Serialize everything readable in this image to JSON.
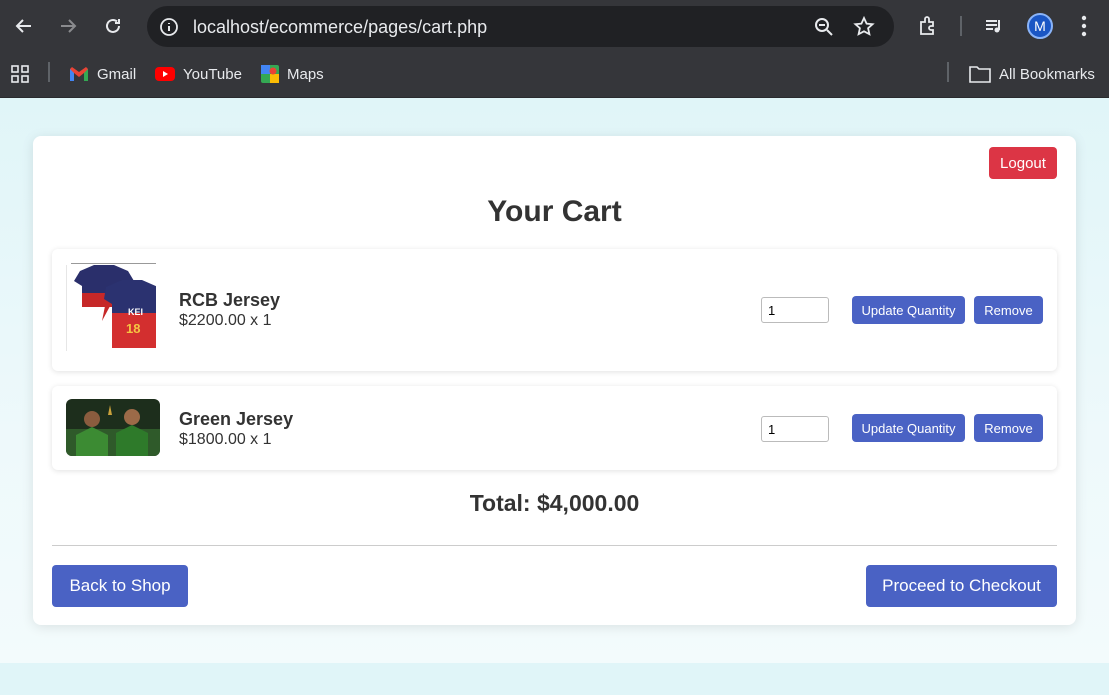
{
  "browser": {
    "url": "localhost/ecommerce/pages/cart.php",
    "avatar_letter": "M",
    "bookmarks": [
      {
        "label": "Gmail"
      },
      {
        "label": "YouTube"
      },
      {
        "label": "Maps"
      }
    ],
    "all_bookmarks_label": "All Bookmarks"
  },
  "page": {
    "logout_label": "Logout",
    "title": "Your Cart",
    "items": [
      {
        "name": "RCB Jersey",
        "price_line": "$2200.00 x 1",
        "quantity": "1",
        "update_label": "Update Quantity",
        "remove_label": "Remove"
      },
      {
        "name": "Green Jersey",
        "price_line": "$1800.00 x 1",
        "quantity": "1",
        "update_label": "Update Quantity",
        "remove_label": "Remove"
      }
    ],
    "total": "Total: $4,000.00",
    "back_label": "Back to Shop",
    "checkout_label": "Proceed to Checkout"
  },
  "colors": {
    "accent": "#4a62c4",
    "danger": "#dc3545",
    "page_bg": "#e0f5f8"
  }
}
